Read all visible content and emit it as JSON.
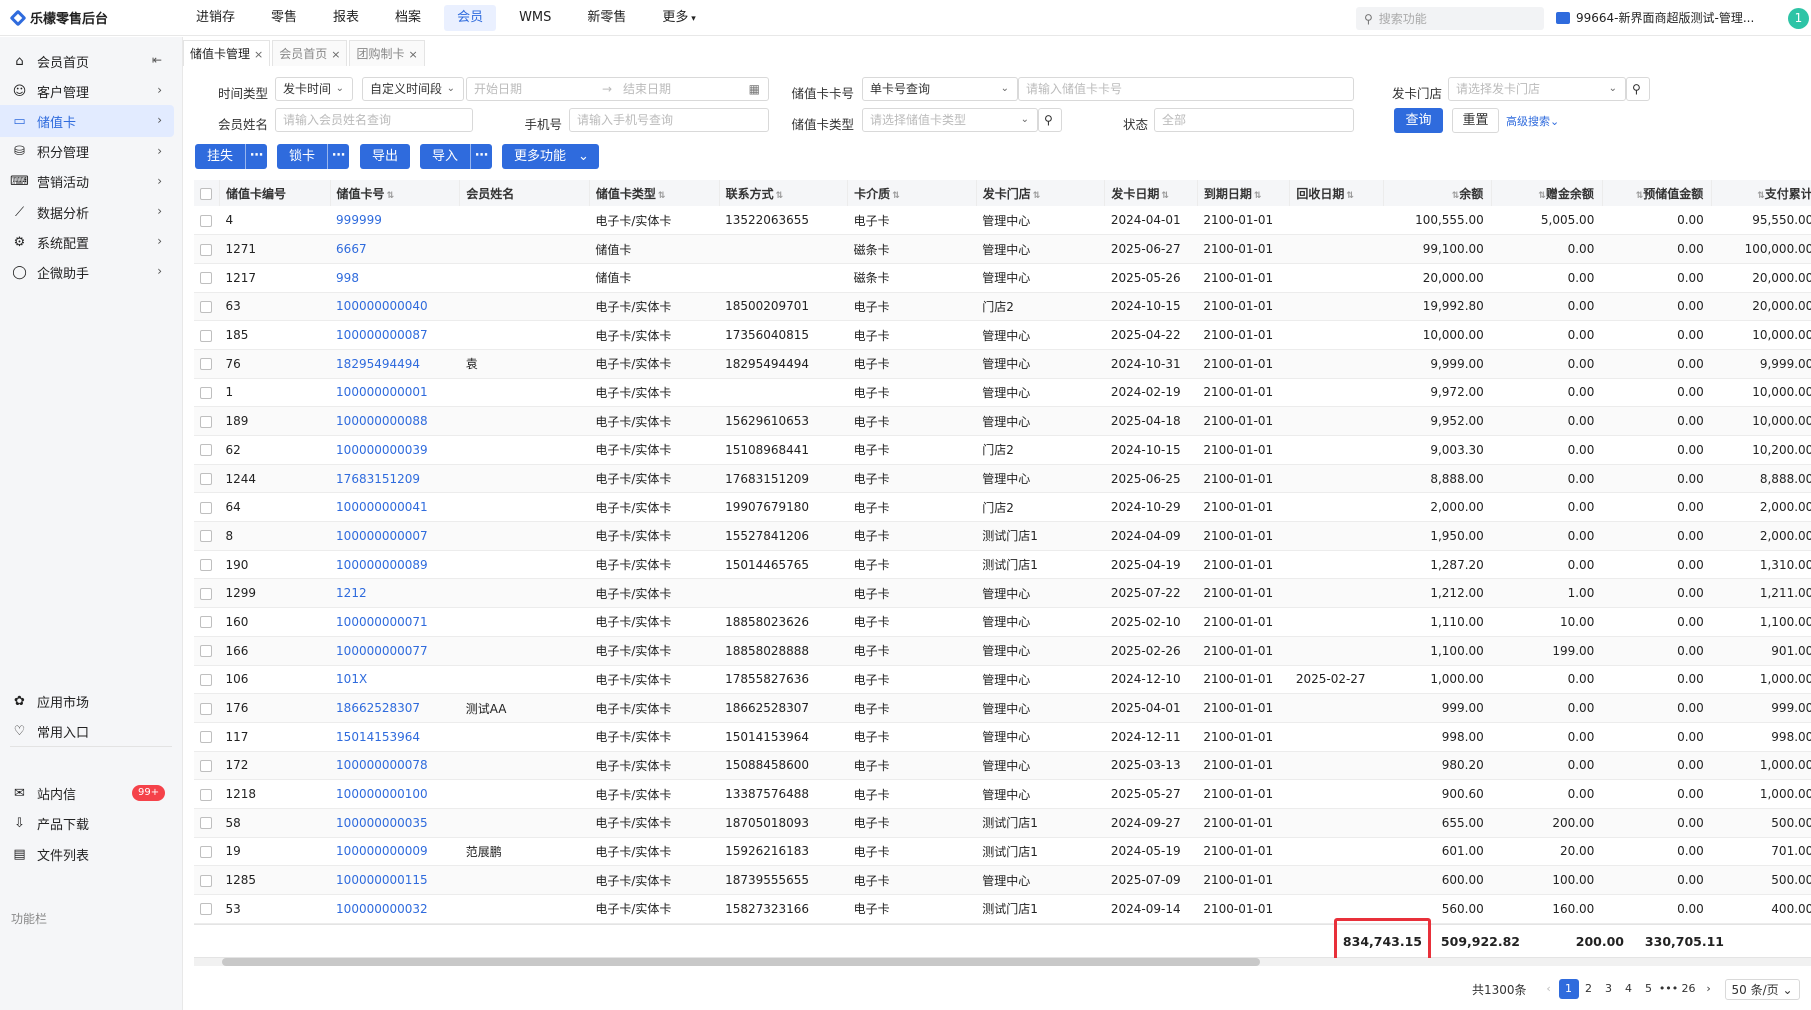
{
  "app": {
    "title": "乐檬零售后台"
  },
  "topnav": [
    "进销存",
    "零售",
    "报表",
    "档案",
    "会员",
    "WMS",
    "新零售",
    "更多"
  ],
  "topnav_active": 4,
  "search": {
    "placeholder": "搜索功能"
  },
  "store_label": "99664-新界面商超版测试-管理...",
  "user_initial": "1",
  "sidebar": {
    "items": [
      "会员首页",
      "客户管理",
      "储值卡",
      "积分管理",
      "营销活动",
      "数据分析",
      "系统配置",
      "企微助手"
    ],
    "active": 2,
    "bottom": [
      "应用市场",
      "常用入口"
    ],
    "section": "功能栏",
    "func_items": [
      "站内信",
      "产品下载",
      "文件列表"
    ],
    "badge": "99+"
  },
  "tabs": [
    "储值卡管理",
    "会员首页",
    "团购制卡"
  ],
  "filters": {
    "time_type_label": "时间类型",
    "time_type_value": "发卡时间",
    "period_value": "自定义时间段",
    "start_placeholder": "开始日期",
    "end_placeholder": "结束日期",
    "card_no_label": "储值卡卡号",
    "card_no_mode": "单卡号查询",
    "card_no_placeholder": "请输入储值卡卡号",
    "store_label": "发卡门店",
    "store_placeholder": "请选择发卡门店",
    "member_label": "会员姓名",
    "member_placeholder": "请输入会员姓名查询",
    "phone_label": "手机号",
    "phone_placeholder": "请输入手机号查询",
    "card_type_label": "储值卡类型",
    "card_type_placeholder": "请选择储值卡类型",
    "status_label": "状态",
    "status_value": "全部",
    "query": "查询",
    "reset": "重置",
    "advanced": "高级搜索"
  },
  "actions": [
    "挂失",
    "锁卡",
    "导出",
    "导入",
    "更多功能"
  ],
  "table": {
    "headers": [
      "储值卡编号",
      "储值卡号",
      "会员姓名",
      "储值卡类型",
      "联系方式",
      "卡介质",
      "发卡门店",
      "发卡日期",
      "到期日期",
      "回收日期",
      "余额",
      "赠金余额",
      "预储值金额",
      "支付累计",
      "累计"
    ],
    "rows": [
      [
        "4",
        "999999",
        "",
        "电子卡/实体卡",
        "13522063655",
        "电子卡",
        "管理中心",
        "2024-04-01",
        "2100-01-01",
        "",
        "100,555.00",
        "5,005.00",
        "0.00",
        "95,550.00"
      ],
      [
        "1271",
        "6667",
        "",
        "储值卡",
        "",
        "磁条卡",
        "管理中心",
        "2025-06-27",
        "2100-01-01",
        "",
        "99,100.00",
        "0.00",
        "0.00",
        "100,000.00"
      ],
      [
        "1217",
        "998",
        "",
        "储值卡",
        "",
        "磁条卡",
        "管理中心",
        "2025-05-26",
        "2100-01-01",
        "",
        "20,000.00",
        "0.00",
        "0.00",
        "20,000.00"
      ],
      [
        "63",
        "100000000040",
        "",
        "电子卡/实体卡",
        "18500209701",
        "电子卡",
        "门店2",
        "2024-10-15",
        "2100-01-01",
        "",
        "19,992.80",
        "0.00",
        "0.00",
        "20,000.00"
      ],
      [
        "185",
        "100000000087",
        "",
        "电子卡/实体卡",
        "17356040815",
        "电子卡",
        "管理中心",
        "2025-04-22",
        "2100-01-01",
        "",
        "10,000.00",
        "0.00",
        "0.00",
        "10,000.00"
      ],
      [
        "76",
        "18295494494",
        "袁",
        "电子卡/实体卡",
        "18295494494",
        "电子卡",
        "管理中心",
        "2024-10-31",
        "2100-01-01",
        "",
        "9,999.00",
        "0.00",
        "0.00",
        "9,999.00"
      ],
      [
        "1",
        "100000000001",
        "",
        "电子卡/实体卡",
        "",
        "电子卡",
        "管理中心",
        "2024-02-19",
        "2100-01-01",
        "",
        "9,972.00",
        "0.00",
        "0.00",
        "10,000.00"
      ],
      [
        "189",
        "100000000088",
        "",
        "电子卡/实体卡",
        "15629610653",
        "电子卡",
        "管理中心",
        "2025-04-18",
        "2100-01-01",
        "",
        "9,952.00",
        "0.00",
        "0.00",
        "10,000.00"
      ],
      [
        "62",
        "100000000039",
        "",
        "电子卡/实体卡",
        "15108968441",
        "电子卡",
        "门店2",
        "2024-10-15",
        "2100-01-01",
        "",
        "9,003.30",
        "0.00",
        "0.00",
        "10,200.00"
      ],
      [
        "1244",
        "17683151209",
        "",
        "电子卡/实体卡",
        "17683151209",
        "电子卡",
        "管理中心",
        "2025-06-25",
        "2100-01-01",
        "",
        "8,888.00",
        "0.00",
        "0.00",
        "8,888.00"
      ],
      [
        "64",
        "100000000041",
        "",
        "电子卡/实体卡",
        "19907679180",
        "电子卡",
        "门店2",
        "2024-10-29",
        "2100-01-01",
        "",
        "2,000.00",
        "0.00",
        "0.00",
        "2,000.00"
      ],
      [
        "8",
        "100000000007",
        "",
        "电子卡/实体卡",
        "15527841206",
        "电子卡",
        "测试门店1",
        "2024-04-09",
        "2100-01-01",
        "",
        "1,950.00",
        "0.00",
        "0.00",
        "2,000.00"
      ],
      [
        "190",
        "100000000089",
        "",
        "电子卡/实体卡",
        "15014465765",
        "电子卡",
        "测试门店1",
        "2025-04-19",
        "2100-01-01",
        "",
        "1,287.20",
        "0.00",
        "0.00",
        "1,310.00"
      ],
      [
        "1299",
        "1212",
        "",
        "电子卡/实体卡",
        "",
        "电子卡",
        "管理中心",
        "2025-07-22",
        "2100-01-01",
        "",
        "1,212.00",
        "1.00",
        "0.00",
        "1,211.00"
      ],
      [
        "160",
        "100000000071",
        "",
        "电子卡/实体卡",
        "18858023626",
        "电子卡",
        "管理中心",
        "2025-02-10",
        "2100-01-01",
        "",
        "1,110.00",
        "10.00",
        "0.00",
        "1,100.00"
      ],
      [
        "166",
        "100000000077",
        "",
        "电子卡/实体卡",
        "18858028888",
        "电子卡",
        "管理中心",
        "2025-02-26",
        "2100-01-01",
        "",
        "1,100.00",
        "199.00",
        "0.00",
        "901.00"
      ],
      [
        "106",
        "101X",
        "",
        "电子卡/实体卡",
        "17855827636",
        "电子卡",
        "管理中心",
        "2024-12-10",
        "2100-01-01",
        "2025-02-27",
        "1,000.00",
        "0.00",
        "0.00",
        "1,000.00"
      ],
      [
        "176",
        "18662528307",
        "测试AA",
        "电子卡/实体卡",
        "18662528307",
        "电子卡",
        "管理中心",
        "2025-04-01",
        "2100-01-01",
        "",
        "999.00",
        "0.00",
        "0.00",
        "999.00"
      ],
      [
        "117",
        "15014153964",
        "",
        "电子卡/实体卡",
        "15014153964",
        "电子卡",
        "管理中心",
        "2024-12-11",
        "2100-01-01",
        "",
        "998.00",
        "0.00",
        "0.00",
        "998.00"
      ],
      [
        "172",
        "100000000078",
        "",
        "电子卡/实体卡",
        "15088458600",
        "电子卡",
        "管理中心",
        "2025-03-13",
        "2100-01-01",
        "",
        "980.20",
        "0.00",
        "0.00",
        "1,000.00"
      ],
      [
        "1218",
        "100000000100",
        "",
        "电子卡/实体卡",
        "13387576488",
        "电子卡",
        "管理中心",
        "2025-05-27",
        "2100-01-01",
        "",
        "900.60",
        "0.00",
        "0.00",
        "1,000.00"
      ],
      [
        "58",
        "100000000035",
        "",
        "电子卡/实体卡",
        "18705018093",
        "电子卡",
        "测试门店1",
        "2024-09-27",
        "2100-01-01",
        "",
        "655.00",
        "200.00",
        "0.00",
        "500.00"
      ],
      [
        "19",
        "100000000009",
        "范展鹏",
        "电子卡/实体卡",
        "15926216183",
        "电子卡",
        "测试门店1",
        "2024-05-19",
        "2100-01-01",
        "",
        "601.00",
        "20.00",
        "0.00",
        "701.00"
      ],
      [
        "1285",
        "100000000115",
        "",
        "电子卡/实体卡",
        "18739555655",
        "电子卡",
        "管理中心",
        "2025-07-09",
        "2100-01-01",
        "",
        "600.00",
        "100.00",
        "0.00",
        "500.00"
      ],
      [
        "53",
        "100000000032",
        "",
        "电子卡/实体卡",
        "15827323166",
        "电子卡",
        "测试门店1",
        "2024-09-14",
        "2100-01-01",
        "",
        "560.00",
        "160.00",
        "0.00",
        "400.00"
      ]
    ],
    "totals": {
      "balance": "834,743.15",
      "gift_balance": "509,922.82",
      "prestored": "200.00",
      "pay_total": "330,705.11"
    }
  },
  "pagination": {
    "total": "共1300条",
    "pages": [
      "1",
      "2",
      "3",
      "4",
      "5",
      "•••",
      "26"
    ],
    "active": "1",
    "page_size": "50 条/页"
  },
  "colors": {
    "accent": "#2f6bdd",
    "highlight": "#e8303a"
  }
}
